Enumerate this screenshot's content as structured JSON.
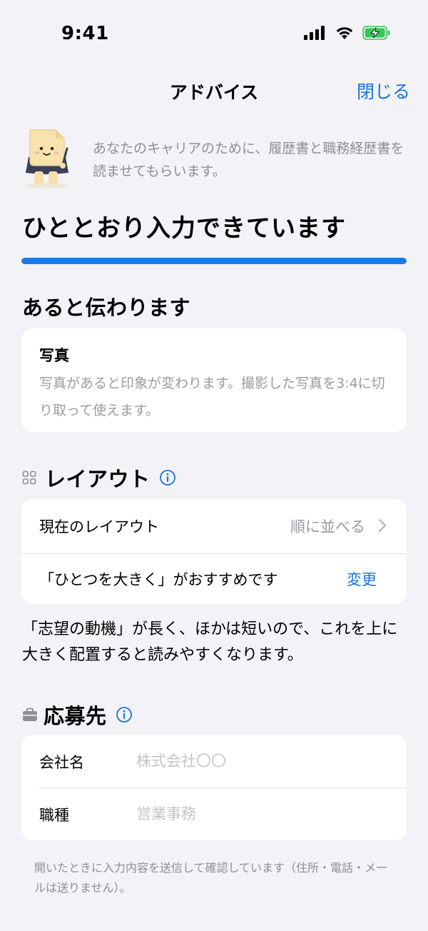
{
  "status_bar": {
    "time": "9:41",
    "battery_color": "#34C759"
  },
  "nav": {
    "title": "アドバイス",
    "close_label": "閉じる",
    "accent_color": "#1A73D9"
  },
  "intro": {
    "mascot_icon": "document-mascot-holding-pen",
    "text": "あなたのキャリアのために、履歴書と職務経歴書を読ませてもらいます。"
  },
  "completion": {
    "title": "ひととおり入力できています",
    "progress_percent": 100,
    "progress_color": "#1B7BE6"
  },
  "suggestions": {
    "heading": "あると伝わります",
    "items": [
      {
        "title": "写真",
        "description": "写真があると印象が変わります。撮影した写真を3:4に切り取って使えます。"
      }
    ]
  },
  "layout_section": {
    "icon": "grid-icon",
    "heading": "レイアウト",
    "info_icon": "info-icon",
    "current_label": "現在のレイアウト",
    "current_value": "順に並べる",
    "recommendation": "「ひとつを大きく」がおすすめです",
    "change_label": "変更",
    "advice": "「志望の動機」が長く、ほかは短いので、これを上に大きく配置すると読みやすくなります。"
  },
  "application_section": {
    "icon": "briefcase-icon",
    "heading": "応募先",
    "info_icon": "info-icon",
    "fields": [
      {
        "label": "会社名",
        "value": "",
        "placeholder": "株式会社〇〇"
      },
      {
        "label": "職種",
        "value": "",
        "placeholder": "営業事務"
      }
    ]
  },
  "footer_note": "開いたときに入力内容を送信して確認しています（住所・電話・メールは送りません）。"
}
